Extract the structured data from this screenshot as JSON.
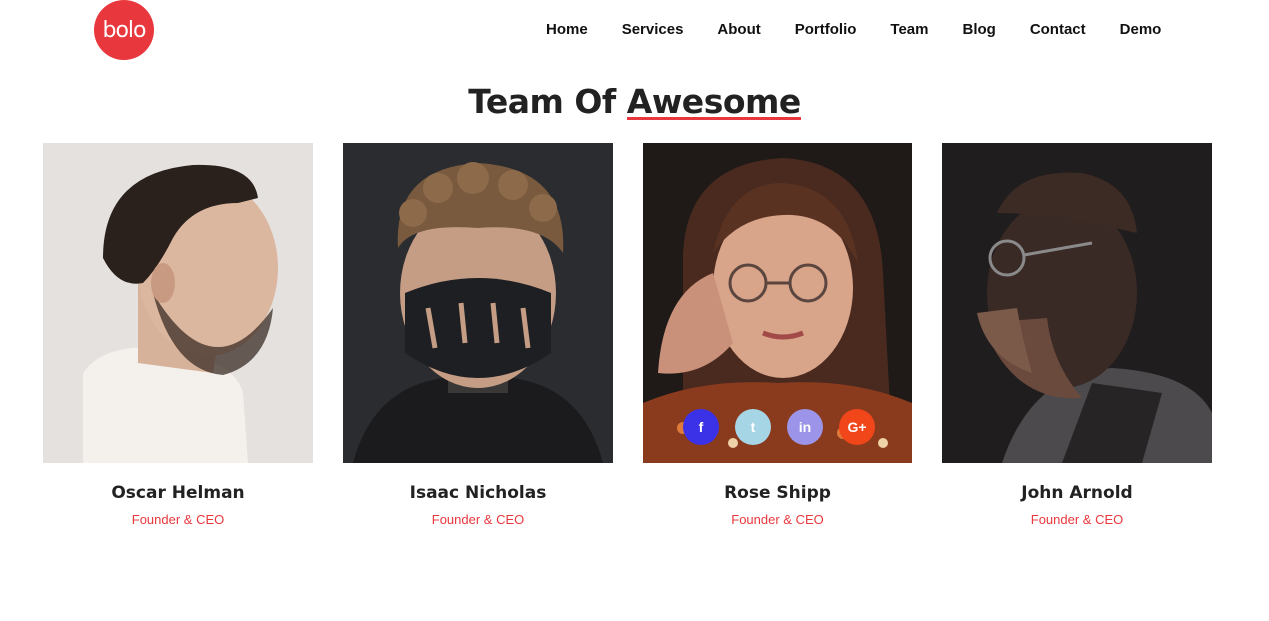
{
  "logo": {
    "text": "bolo"
  },
  "nav": [
    "Home",
    "Services",
    "About",
    "Portfolio",
    "Team",
    "Blog",
    "Contact",
    "Demo"
  ],
  "section": {
    "title_main": "Team Of ",
    "title_accent": "Awesome"
  },
  "team": [
    {
      "name": "Oscar Helman",
      "role": "Founder & CEO"
    },
    {
      "name": "Isaac Nicholas",
      "role": "Founder & CEO"
    },
    {
      "name": "Rose Shipp",
      "role": "Founder & CEO"
    },
    {
      "name": "John Arnold",
      "role": "Founder & CEO"
    }
  ],
  "social_icons": [
    {
      "icon": "facebook-icon",
      "glyph": "f",
      "color": "#3b31e6"
    },
    {
      "icon": "twitter-icon",
      "glyph": "t",
      "color": "#a6d5e6"
    },
    {
      "icon": "linkedin-icon",
      "glyph": "in",
      "color": "#9b94e8"
    },
    {
      "icon": "google-plus-icon",
      "glyph": "G+",
      "color": "#f0461a"
    }
  ],
  "colors": {
    "accent": "#e8383d"
  }
}
